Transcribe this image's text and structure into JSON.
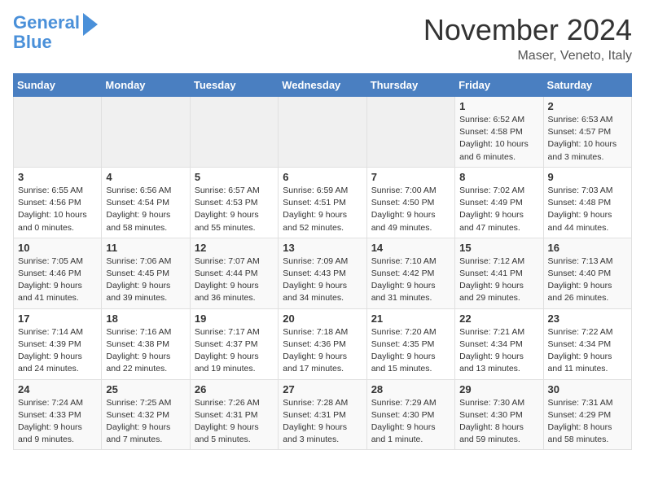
{
  "header": {
    "logo_line1": "General",
    "logo_line2": "Blue",
    "month_title": "November 2024",
    "location": "Maser, Veneto, Italy"
  },
  "weekdays": [
    "Sunday",
    "Monday",
    "Tuesday",
    "Wednesday",
    "Thursday",
    "Friday",
    "Saturday"
  ],
  "weeks": [
    [
      {
        "day": "",
        "info": ""
      },
      {
        "day": "",
        "info": ""
      },
      {
        "day": "",
        "info": ""
      },
      {
        "day": "",
        "info": ""
      },
      {
        "day": "",
        "info": ""
      },
      {
        "day": "1",
        "info": "Sunrise: 6:52 AM\nSunset: 4:58 PM\nDaylight: 10 hours and 6 minutes."
      },
      {
        "day": "2",
        "info": "Sunrise: 6:53 AM\nSunset: 4:57 PM\nDaylight: 10 hours and 3 minutes."
      }
    ],
    [
      {
        "day": "3",
        "info": "Sunrise: 6:55 AM\nSunset: 4:56 PM\nDaylight: 10 hours and 0 minutes."
      },
      {
        "day": "4",
        "info": "Sunrise: 6:56 AM\nSunset: 4:54 PM\nDaylight: 9 hours and 58 minutes."
      },
      {
        "day": "5",
        "info": "Sunrise: 6:57 AM\nSunset: 4:53 PM\nDaylight: 9 hours and 55 minutes."
      },
      {
        "day": "6",
        "info": "Sunrise: 6:59 AM\nSunset: 4:51 PM\nDaylight: 9 hours and 52 minutes."
      },
      {
        "day": "7",
        "info": "Sunrise: 7:00 AM\nSunset: 4:50 PM\nDaylight: 9 hours and 49 minutes."
      },
      {
        "day": "8",
        "info": "Sunrise: 7:02 AM\nSunset: 4:49 PM\nDaylight: 9 hours and 47 minutes."
      },
      {
        "day": "9",
        "info": "Sunrise: 7:03 AM\nSunset: 4:48 PM\nDaylight: 9 hours and 44 minutes."
      }
    ],
    [
      {
        "day": "10",
        "info": "Sunrise: 7:05 AM\nSunset: 4:46 PM\nDaylight: 9 hours and 41 minutes."
      },
      {
        "day": "11",
        "info": "Sunrise: 7:06 AM\nSunset: 4:45 PM\nDaylight: 9 hours and 39 minutes."
      },
      {
        "day": "12",
        "info": "Sunrise: 7:07 AM\nSunset: 4:44 PM\nDaylight: 9 hours and 36 minutes."
      },
      {
        "day": "13",
        "info": "Sunrise: 7:09 AM\nSunset: 4:43 PM\nDaylight: 9 hours and 34 minutes."
      },
      {
        "day": "14",
        "info": "Sunrise: 7:10 AM\nSunset: 4:42 PM\nDaylight: 9 hours and 31 minutes."
      },
      {
        "day": "15",
        "info": "Sunrise: 7:12 AM\nSunset: 4:41 PM\nDaylight: 9 hours and 29 minutes."
      },
      {
        "day": "16",
        "info": "Sunrise: 7:13 AM\nSunset: 4:40 PM\nDaylight: 9 hours and 26 minutes."
      }
    ],
    [
      {
        "day": "17",
        "info": "Sunrise: 7:14 AM\nSunset: 4:39 PM\nDaylight: 9 hours and 24 minutes."
      },
      {
        "day": "18",
        "info": "Sunrise: 7:16 AM\nSunset: 4:38 PM\nDaylight: 9 hours and 22 minutes."
      },
      {
        "day": "19",
        "info": "Sunrise: 7:17 AM\nSunset: 4:37 PM\nDaylight: 9 hours and 19 minutes."
      },
      {
        "day": "20",
        "info": "Sunrise: 7:18 AM\nSunset: 4:36 PM\nDaylight: 9 hours and 17 minutes."
      },
      {
        "day": "21",
        "info": "Sunrise: 7:20 AM\nSunset: 4:35 PM\nDaylight: 9 hours and 15 minutes."
      },
      {
        "day": "22",
        "info": "Sunrise: 7:21 AM\nSunset: 4:34 PM\nDaylight: 9 hours and 13 minutes."
      },
      {
        "day": "23",
        "info": "Sunrise: 7:22 AM\nSunset: 4:34 PM\nDaylight: 9 hours and 11 minutes."
      }
    ],
    [
      {
        "day": "24",
        "info": "Sunrise: 7:24 AM\nSunset: 4:33 PM\nDaylight: 9 hours and 9 minutes."
      },
      {
        "day": "25",
        "info": "Sunrise: 7:25 AM\nSunset: 4:32 PM\nDaylight: 9 hours and 7 minutes."
      },
      {
        "day": "26",
        "info": "Sunrise: 7:26 AM\nSunset: 4:31 PM\nDaylight: 9 hours and 5 minutes."
      },
      {
        "day": "27",
        "info": "Sunrise: 7:28 AM\nSunset: 4:31 PM\nDaylight: 9 hours and 3 minutes."
      },
      {
        "day": "28",
        "info": "Sunrise: 7:29 AM\nSunset: 4:30 PM\nDaylight: 9 hours and 1 minute."
      },
      {
        "day": "29",
        "info": "Sunrise: 7:30 AM\nSunset: 4:30 PM\nDaylight: 8 hours and 59 minutes."
      },
      {
        "day": "30",
        "info": "Sunrise: 7:31 AM\nSunset: 4:29 PM\nDaylight: 8 hours and 58 minutes."
      }
    ]
  ]
}
